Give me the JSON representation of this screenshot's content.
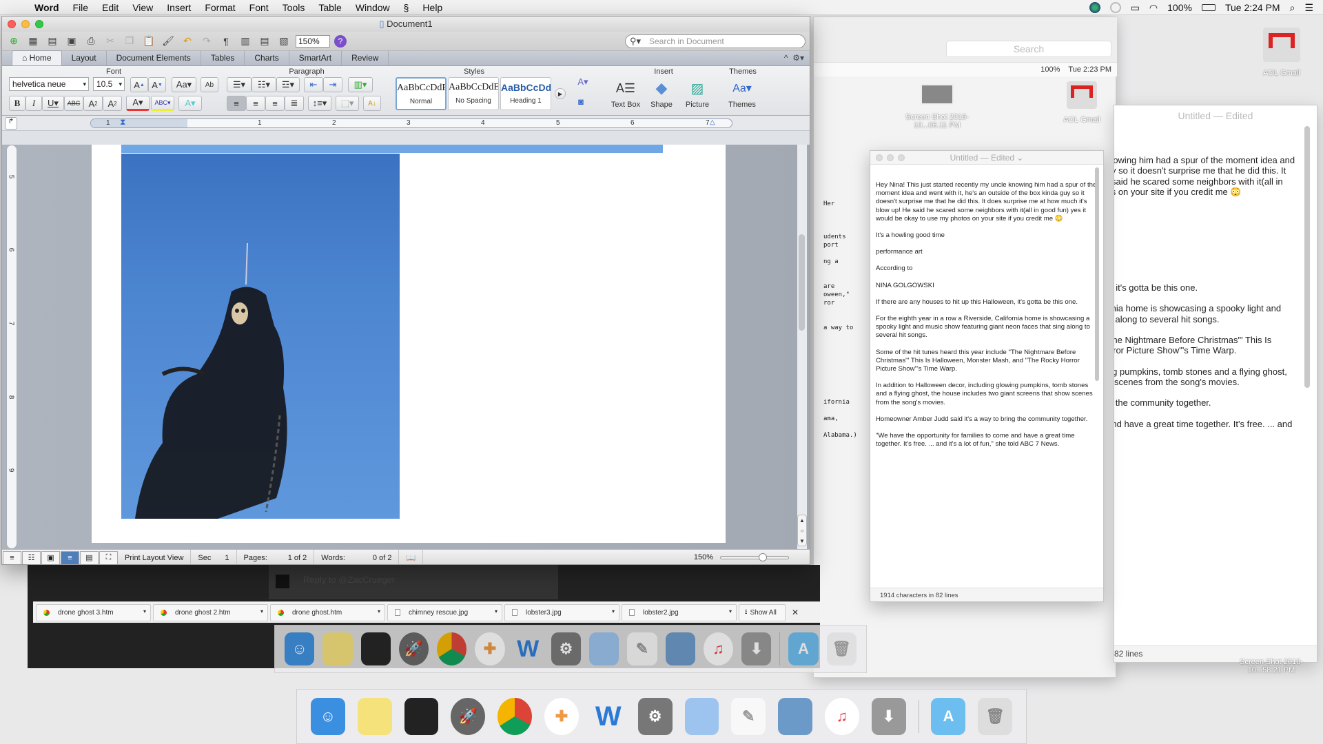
{
  "menubar": {
    "app": "Word",
    "items": [
      "File",
      "Edit",
      "View",
      "Insert",
      "Format",
      "Font",
      "Tools",
      "Table",
      "Window",
      "Help"
    ],
    "battery": "100%",
    "clock": "Tue 2:24 PM"
  },
  "word": {
    "title": "Document1",
    "zoom": "150%",
    "search_placeholder": "Search in Document",
    "tabs": [
      "Home",
      "Layout",
      "Document Elements",
      "Tables",
      "Charts",
      "SmartArt",
      "Review"
    ],
    "active_tab": "Home",
    "ribbon": {
      "font_group": "Font",
      "paragraph_group": "Paragraph",
      "styles_group": "Styles",
      "insert_group": "Insert",
      "themes_group": "Themes",
      "font_name": "helvetica neue",
      "font_size": "10.5",
      "styles": [
        {
          "preview": "AaBbCcDdEe",
          "name": "Normal"
        },
        {
          "preview": "AaBbCcDdEe",
          "name": "No Spacing"
        },
        {
          "preview": "AaBbCcDd",
          "name": "Heading 1"
        }
      ],
      "insert_items": [
        "Text Box",
        "Shape",
        "Picture"
      ],
      "themes_label": "Themes"
    },
    "ruler_numbers": [
      "1",
      "1",
      "2",
      "3",
      "4",
      "5",
      "6",
      "7"
    ],
    "vruler_numbers": [
      "5",
      "6",
      "7",
      "8",
      "9"
    ],
    "status": {
      "view": "Print Layout View",
      "sec_label": "Sec",
      "sec": "1",
      "pages_label": "Pages:",
      "pages": "1 of 2",
      "words_label": "Words:",
      "words": "0 of 2",
      "zoom": "150%"
    }
  },
  "chrome": {
    "reply_text": "Reply to @ZacCrueger",
    "downloads": [
      "drone ghost 3.htm",
      "drone ghost 2.htm",
      "drone ghost.htm",
      "chimney rescue.jpg",
      "lobster3.jpg",
      "lobster2.jpg"
    ],
    "show_all": "Show All"
  },
  "background_window": {
    "search_placeholder": "Search",
    "battery": "100%",
    "clock": "Tue 2:23 PM",
    "code_fragments": [
      "Her",
      "udents",
      "port",
      "ng a",
      "are",
      "oween,\"",
      "ror",
      "a way to",
      "ifornia",
      "ama,",
      "Alabama.)"
    ]
  },
  "desktop_icons": [
    {
      "label": "Screen Shot 2016-10...06.11 PM"
    },
    {
      "label": "AOL Gmail"
    },
    {
      "label": "Screen Shot 2016-10...58.21 PM"
    }
  ],
  "textedit": {
    "title": "Untitled",
    "edited": "— Edited",
    "paragraphs": [
      "Hey Nina! This just started recently my uncle knowing him had a spur of the moment idea and went with it, he's an outside of the box kinda guy so it doesn't surprise me that he did this. It does surprise me at how much it's blow up! He said he scared some neighbors with it(all in good fun) yes it would be okay to use my photos on your site if you credit me 😳",
      "It's a howling good time",
      "performance art",
      "According to",
      "NINA GOLGOWSKI",
      "If there are any houses to hit up this Halloween, it's gotta be this one.",
      "For the eighth year in a row a Riverside, California home is showcasing a spooky light and music show featuring giant neon faces that sing along to several hit songs.",
      "Some of the hit tunes heard this year include \"The Nightmare Before Christmas\"' This Is Halloween, Monster Mash, and \"The Rocky Horror Picture Show\"'s Time Warp.",
      "In addition to Halloween decor, including glowing pumpkins, tomb stones and a flying ghost, the house includes two giant screens that show scenes from the song's movies.",
      "Homeowner Amber Judd said it's a way to bring the community together.",
      "\"We have the opportunity for families to come and have a great time together. It's free. ... and it's a lot of fun,\" she told ABC 7 News."
    ],
    "footer": "1914 characters in 82 lines",
    "footer_bg": "82 lines"
  },
  "dock": {
    "apps": [
      "Finder",
      "Notes",
      "Mission Control",
      "Launchpad",
      "Chrome",
      "Microsoft Office",
      "Word",
      "System Preferences",
      "TextEdit Doc",
      "TextEdit",
      "Preview",
      "iTunes",
      "Installer"
    ],
    "folders": [
      "Applications",
      "Trash"
    ]
  }
}
